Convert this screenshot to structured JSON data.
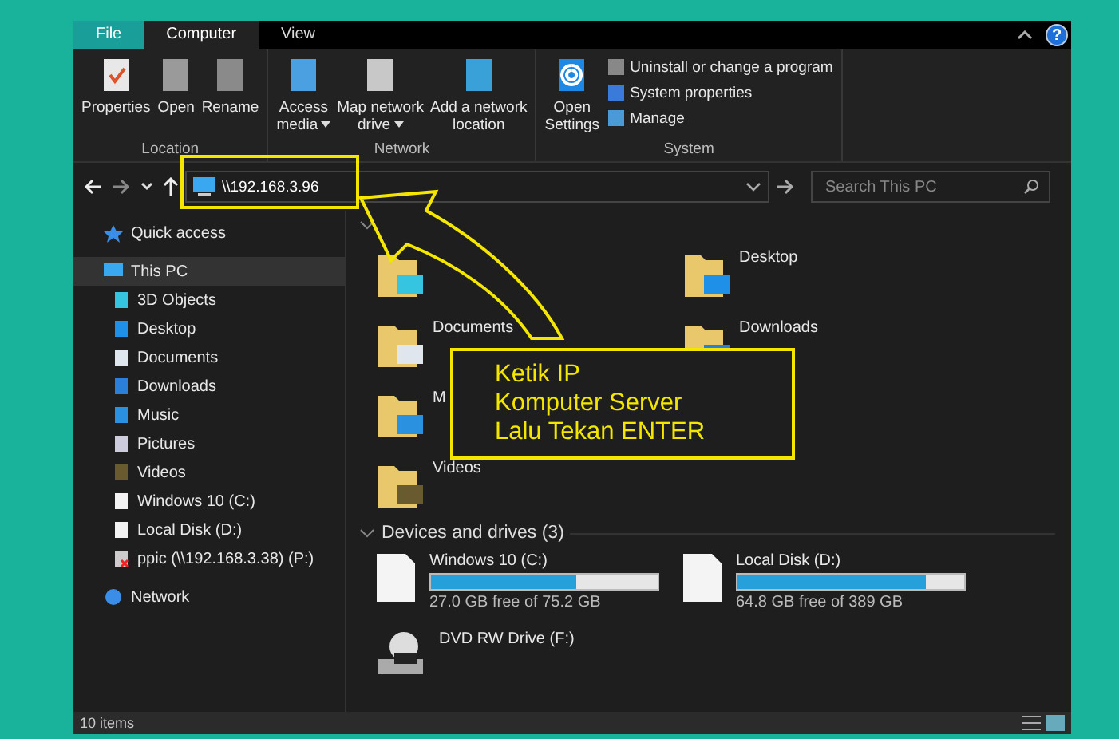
{
  "ribbon": {
    "tabs": [
      {
        "label": "File",
        "selected": false,
        "kind": "file"
      },
      {
        "label": "Computer",
        "selected": true,
        "kind": "tab"
      },
      {
        "label": "View",
        "selected": false,
        "kind": "tab"
      }
    ],
    "help": "?",
    "groups": [
      {
        "label": "Location",
        "buttons": [
          {
            "label": "Properties",
            "dropdown": false
          },
          {
            "label": "Open",
            "dropdown": false
          },
          {
            "label": "Rename",
            "dropdown": false
          }
        ]
      },
      {
        "label": "Network",
        "buttons": [
          {
            "label": "Access\nmedia",
            "dropdown": true
          },
          {
            "label": "Map network\ndrive",
            "dropdown": true
          },
          {
            "label": "Add a network\nlocation",
            "dropdown": false
          }
        ]
      },
      {
        "label": "System",
        "buttons": [
          {
            "label": "Open\nSettings",
            "dropdown": false
          }
        ],
        "small": [
          "Uninstall or change a program",
          "System properties",
          "Manage"
        ]
      }
    ]
  },
  "address": {
    "value": "\\\\192.168.3.96"
  },
  "search": {
    "placeholder": "Search This PC"
  },
  "sidebar": {
    "items": [
      {
        "label": "Quick access",
        "selected": false
      },
      {
        "label": "This PC",
        "selected": true,
        "children": [
          {
            "label": "3D Objects",
            "selected": false
          },
          {
            "label": "Desktop",
            "selected": false
          },
          {
            "label": "Documents",
            "selected": false
          },
          {
            "label": "Downloads",
            "selected": false
          },
          {
            "label": "Music",
            "selected": false
          },
          {
            "label": "Pictures",
            "selected": false
          },
          {
            "label": "Videos",
            "selected": false
          },
          {
            "label": "Windows 10 (C:)",
            "selected": false
          },
          {
            "label": "Local Disk (D:)",
            "selected": false
          },
          {
            "label": "ppic (\\\\192.168.3.38) (P:)",
            "selected": false
          }
        ]
      },
      {
        "label": "Network",
        "selected": false
      }
    ]
  },
  "folders": [
    {
      "kind": "folder"
    },
    {
      "kind": "folder",
      "label": "Documents"
    },
    {
      "kind": "folder",
      "label": "M"
    },
    {
      "kind": "folder",
      "label": "Videos"
    },
    {
      "kind": "folder",
      "label": "Desktop"
    },
    {
      "kind": "folder",
      "label": "Downloads"
    }
  ],
  "drives_section": {
    "title": "Devices and drives (3)",
    "drives": [
      {
        "kind": "disk",
        "name": "Windows 10 (C:)",
        "level": 0.64,
        "reading": "27.0 GB free of 75.2 GB"
      },
      {
        "kind": "disk",
        "name": "Local Disk (D:)",
        "level": 0.83,
        "reading": "64.8 GB free of 389 GB"
      },
      {
        "kind": "dvd",
        "name": "DVD RW Drive (F:)"
      }
    ]
  },
  "status_bar": {
    "text": "10 items"
  },
  "callout": {
    "text": "Ketik IP\nKomputer Server\nLalu Tekan ENTER"
  }
}
